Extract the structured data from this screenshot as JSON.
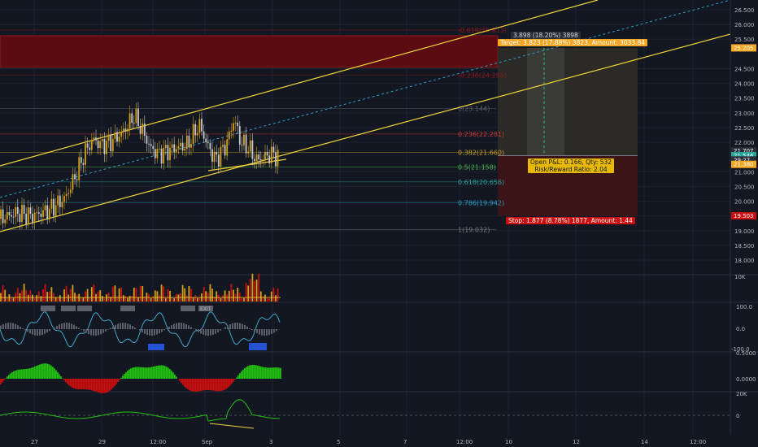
{
  "colors": {
    "background": "#131722",
    "grid": "#1e222d",
    "candle_up": "#d4a017",
    "candle_down": "#2a2e39",
    "channel": "#f0d43a",
    "channel_mid": "#2a9dc4",
    "target": "#f5a623",
    "stop": "#cc0e0e",
    "open_box": "#e6b800",
    "osc_positive": "#22c110",
    "osc_negative": "#c90e0e",
    "wave": "#3fa7c9"
  },
  "price_axis": {
    "ticks": [
      "26.500",
      "26.000",
      "25.500",
      "24.500",
      "24.000",
      "23.500",
      "23.000",
      "22.500",
      "22.000",
      "21.000",
      "20.500",
      "20.000",
      "19.500",
      "19.000",
      "18.500",
      "18.000"
    ],
    "tick_values": [
      26.5,
      26.0,
      25.5,
      24.5,
      24.0,
      23.5,
      23.0,
      22.5,
      22.0,
      21.0,
      20.5,
      20.0,
      19.5,
      19.0,
      18.5,
      18.0
    ],
    "tags": [
      {
        "label": "25.205",
        "value": 25.205,
        "color": "#f5a623"
      },
      {
        "label": "21.707",
        "value": 21.707,
        "color": "#2a2e39"
      },
      {
        "label": "21.546",
        "value": 21.546,
        "color": "#26a69a"
      },
      {
        "label": "29:27",
        "value": 21.4,
        "color": "#2a2e39"
      },
      {
        "label": "21.380",
        "value": 21.25,
        "color": "#f5a623"
      },
      {
        "label": "19.503",
        "value": 19.503,
        "color": "#cc0e0e"
      }
    ]
  },
  "time_axis": {
    "labels": [
      "27",
      "29",
      "12:00",
      "Sep",
      "3",
      "5",
      "7",
      "12:00",
      "10",
      "12",
      "14",
      "12:00"
    ]
  },
  "fibonacci": [
    {
      "label": "-0.618(25.813)",
      "value": 25.813,
      "color": "#8b1a1a"
    },
    {
      "label": "-0.236(24.285)",
      "value": 24.285,
      "color": "#8b1a1a"
    },
    {
      "label": "0(23.144)",
      "value": 23.144,
      "color": "#5d606b"
    },
    {
      "label": "0.236(22.281)",
      "value": 22.281,
      "color": "#c23b3b"
    },
    {
      "label": "0.382(21.660)",
      "value": 21.66,
      "color": "#c9a227"
    },
    {
      "label": "0.5(21.158)",
      "value": 21.158,
      "color": "#4caf50"
    },
    {
      "label": "0.618(20.656)",
      "value": 20.656,
      "color": "#26a69a"
    },
    {
      "label": "0.786(19.942)",
      "value": 19.942,
      "color": "#2a9dc4"
    },
    {
      "label": "1(19.032)",
      "value": 19.032,
      "color": "#787b86"
    }
  ],
  "position": {
    "range_label": "3.898 (18.20%) 3898",
    "target_label": "Target: 3.823 (17.88%) 3823, Amount: 3033.84",
    "open_pl_label": "Open P&L: 0.166, Qty: 532",
    "risk_reward_label": "Risk/Reward Ratio: 2.04",
    "stop_label": "Stop: 1.877 (8.78%) 1877, Amount: 1.44",
    "entry_price": 21.546,
    "target_price": 25.205,
    "stop_price": 19.503
  },
  "volume_pane": {
    "scale_label": "10K"
  },
  "oscillator_pane": {
    "ticks": [
      "100.0",
      "0.0",
      "-100.0"
    ],
    "badges": [
      "",
      "",
      "",
      "",
      "",
      "EXIT",
      "",
      ""
    ]
  },
  "histogram_pane": {
    "ticks": [
      "0.5000",
      "0.0000"
    ]
  },
  "line_pane": {
    "ticks": [
      "20K",
      "0"
    ]
  }
}
